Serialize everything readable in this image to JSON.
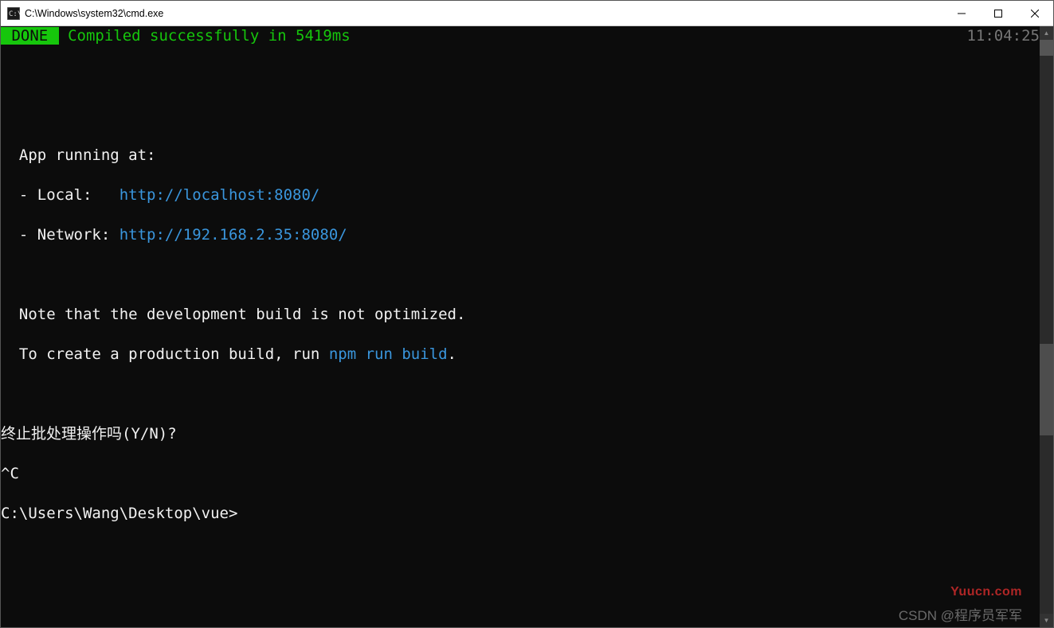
{
  "window": {
    "title": "C:\\Windows\\system32\\cmd.exe"
  },
  "status": {
    "done_badge": " DONE ",
    "compiled_msg": " Compiled successfully in 5419ms",
    "timestamp": "11:04:25"
  },
  "output": {
    "running_header": "  App running at:",
    "local_prefix": "  - Local:   ",
    "local_url": "http://localhost:8080/",
    "network_prefix": "  - Network: ",
    "network_url": "http://192.168.2.35:8080/",
    "note_line": "  Note that the development build is not optimized.",
    "create_prefix": "  To create a production build, run ",
    "create_cmd": "npm run build",
    "create_suffix": ".",
    "terminate_prompt": "终止批处理操作吗(Y/N)?",
    "ctrl_c": "^C",
    "prompt": "C:\\Users\\Wang\\Desktop\\vue>"
  },
  "watermarks": {
    "red": "Yuucn.com",
    "gray": "CSDN @程序员军军"
  }
}
